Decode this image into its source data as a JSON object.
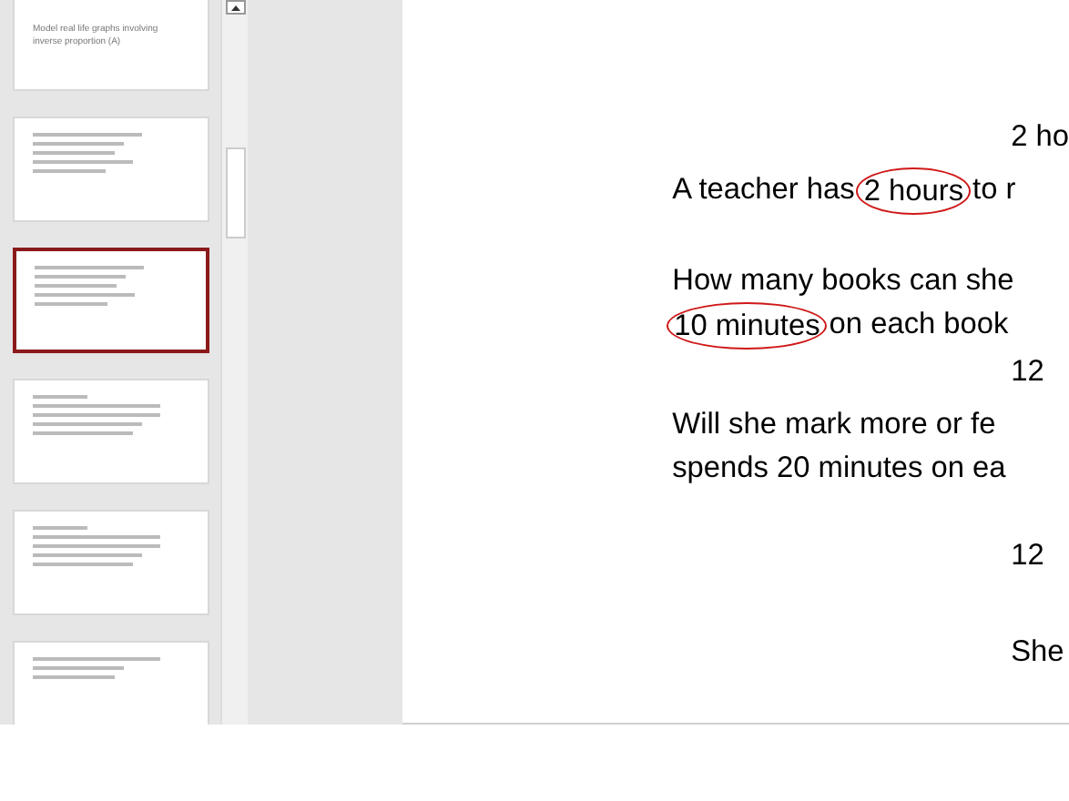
{
  "thumbnails": [
    {
      "kind": "title",
      "title": "Model real life graphs involving inverse proportion (A)",
      "selected": false
    },
    {
      "kind": "text",
      "selected": false
    },
    {
      "kind": "text",
      "selected": true
    },
    {
      "kind": "table",
      "selected": false
    },
    {
      "kind": "table",
      "selected": false
    },
    {
      "kind": "graph",
      "selected": false
    }
  ],
  "slide": {
    "lines": [
      {
        "kind": "calc",
        "segments": [
          {
            "text": "2 ho",
            "circled": false
          }
        ]
      },
      {
        "kind": "line",
        "segments": [
          {
            "text": "A teacher has",
            "circled": false
          },
          {
            "text": "2 hours",
            "circled": true
          },
          {
            "text": "to r",
            "circled": false
          }
        ]
      },
      {
        "kind": "gap"
      },
      {
        "kind": "line",
        "segments": [
          {
            "text": "How many books can she",
            "circled": false
          }
        ]
      },
      {
        "kind": "line",
        "segments": [
          {
            "text": "10 minutes",
            "circled": true
          },
          {
            "text": "on each book",
            "circled": false
          }
        ]
      },
      {
        "kind": "calc",
        "segments": [
          {
            "text": "12",
            "circled": false
          }
        ]
      },
      {
        "kind": "line",
        "segments": [
          {
            "text": "Will she mark more or fe",
            "circled": false
          }
        ]
      },
      {
        "kind": "line",
        "segments": [
          {
            "text": "spends 20 minutes on ea",
            "circled": false
          }
        ]
      },
      {
        "kind": "gap"
      },
      {
        "kind": "calc",
        "segments": [
          {
            "text": "12",
            "circled": false
          }
        ]
      },
      {
        "kind": "gap"
      },
      {
        "kind": "calc",
        "segments": [
          {
            "text": "She",
            "circled": false
          }
        ]
      }
    ]
  }
}
